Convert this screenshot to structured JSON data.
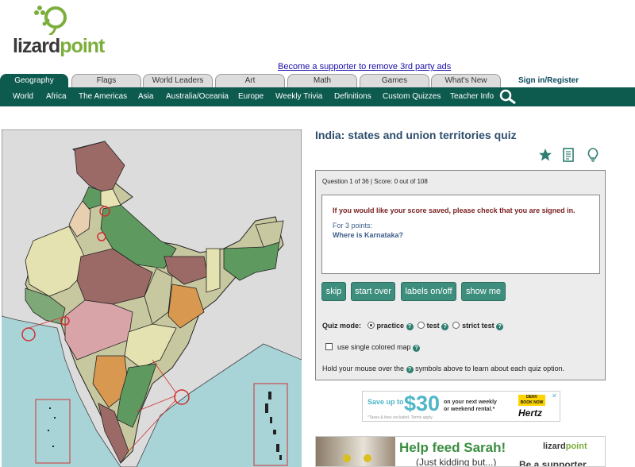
{
  "logo": {
    "word_part1": "lizard",
    "word_part2": "point"
  },
  "supporter_link": "Become a supporter to remove 3rd party ads",
  "tabs": [
    {
      "label": "Geography",
      "active": true
    },
    {
      "label": "Flags",
      "active": false
    },
    {
      "label": "World Leaders",
      "active": false
    },
    {
      "label": "Art",
      "active": false
    },
    {
      "label": "Math",
      "active": false
    },
    {
      "label": "Games",
      "active": false
    },
    {
      "label": "What's New",
      "active": false
    }
  ],
  "signin": "Sign in/Register",
  "nav": [
    "World",
    "Africa",
    "The Americas",
    "Asia",
    "Australia/Oceania",
    "Europe",
    "Weekly Trivia",
    "Definitions",
    "Custom Quizzes",
    "Teacher Info"
  ],
  "quiz": {
    "title": "India: states and union territories quiz",
    "status": "Question 1 of 36 | Score: 0 out of 108",
    "warning": "If you would like your score saved, please check that you are signed in.",
    "points": "For 3 points:",
    "question": "Where is Karnataka?",
    "buttons": [
      "skip",
      "start over",
      "labels on/off",
      "show me"
    ],
    "mode_label": "Quiz mode:",
    "modes": [
      "practice",
      "test",
      "strict test"
    ],
    "selected_mode": "practice",
    "single_color_label": "use single colored map",
    "hint": "Hold your mouse over the symbols above to learn about each quiz option.",
    "help_symbol": "?"
  },
  "tool_icons": [
    "star-icon",
    "document-icon",
    "lightbulb-icon"
  ],
  "colors": {
    "nav_bg": "#0d5a4e",
    "button_bg": "#3e8e7e",
    "sea": "#a8d4d8",
    "title": "#2e4e6e"
  },
  "ads": {
    "hertz": {
      "save": "Save up to",
      "amount": "$30",
      "sub1": "on your next weekly",
      "sub2": "or weekend rental.*",
      "fine": "*Taxes & fees excluded. Terms apply.",
      "book1": "DENV",
      "book2": "BOOK NOW",
      "brand": "Hertz",
      "close": "✕"
    },
    "sarah": {
      "headline": "Help feed Sarah!",
      "subline": "(Just kidding but...)",
      "brand_part1": "lizard",
      "brand_part2": "point",
      "cta": "Be a supporter"
    }
  }
}
